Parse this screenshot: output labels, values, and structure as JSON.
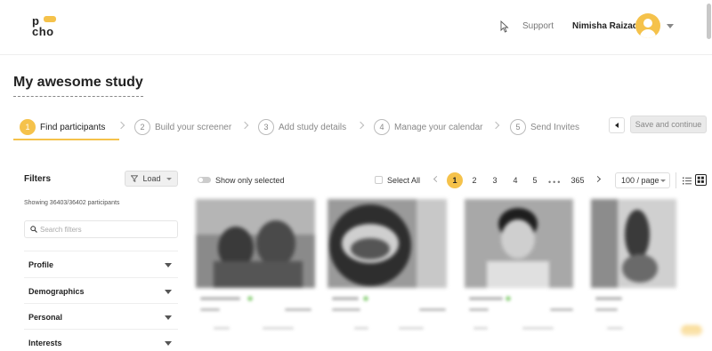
{
  "header": {
    "logo_top": "p",
    "logo_bottom": "cho",
    "support_label": "Support",
    "user_name": "Nimisha Raizada"
  },
  "page": {
    "title": "My awesome study"
  },
  "stepper": {
    "steps": [
      {
        "number": "1",
        "label": "Find participants",
        "active": true
      },
      {
        "number": "2",
        "label": "Build your screener",
        "active": false
      },
      {
        "number": "3",
        "label": "Add study details",
        "active": false
      },
      {
        "number": "4",
        "label": "Manage your calendar",
        "active": false
      },
      {
        "number": "5",
        "label": "Send Invites",
        "active": false
      }
    ],
    "save_label": "Save and continue"
  },
  "filters": {
    "title": "Filters",
    "load_label": "Load",
    "showing_text": "Showing 36403/36402 participants",
    "search_placeholder": "Search filters",
    "sections": [
      "Profile",
      "Demographics",
      "Personal",
      "Interests"
    ]
  },
  "toolbar": {
    "show_selected_label": "Show only selected",
    "select_all_label": "Select All",
    "pages": [
      "1",
      "2",
      "3",
      "4",
      "5"
    ],
    "current_page": "1",
    "ellipsis": "•••",
    "last_page": "365",
    "per_page": "100 / page"
  },
  "colors": {
    "accent": "#f5c24b",
    "muted_text": "#888888",
    "online_dot": "#9ed68f"
  },
  "icons": [
    "cursor-icon",
    "chevron-down-icon",
    "back-arrow-icon",
    "filter-funnel-icon",
    "search-icon",
    "list-view-icon",
    "grid-view-icon",
    "avatar-icon"
  ]
}
